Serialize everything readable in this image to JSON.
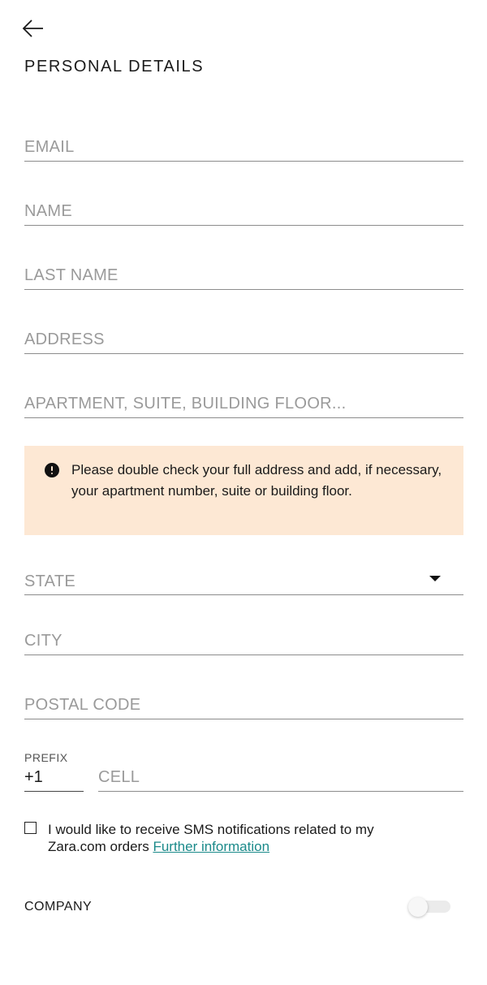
{
  "header": {
    "title": "PERSONAL DETAILS"
  },
  "form": {
    "email_placeholder": "EMAIL",
    "name_placeholder": "NAME",
    "last_name_placeholder": "LAST NAME",
    "address_placeholder": "ADDRESS",
    "apartment_placeholder": "APARTMENT, SUITE, BUILDING FLOOR...",
    "notice_text": "Please double check your full address and add, if necessary, your apartment number, suite or building floor.",
    "state_placeholder": "STATE",
    "city_placeholder": "CITY",
    "postal_code_placeholder": "POSTAL CODE",
    "prefix_label": "PREFIX",
    "prefix_value": "+1",
    "cell_placeholder": "CELL",
    "sms_text": "I would like to receive SMS notifications related to my Zara.com orders",
    "sms_link": "Further information",
    "sms_checked": false,
    "company_label": "COMPANY",
    "company_enabled": false
  },
  "colors": {
    "notice_background": "#fde8d4",
    "link": "#1b8a8a",
    "placeholder": "#9a9a9a"
  },
  "icons": {
    "back": "arrow-left-icon",
    "notice": "exclamation-circle-icon",
    "state_dropdown": "caret-down-icon"
  }
}
